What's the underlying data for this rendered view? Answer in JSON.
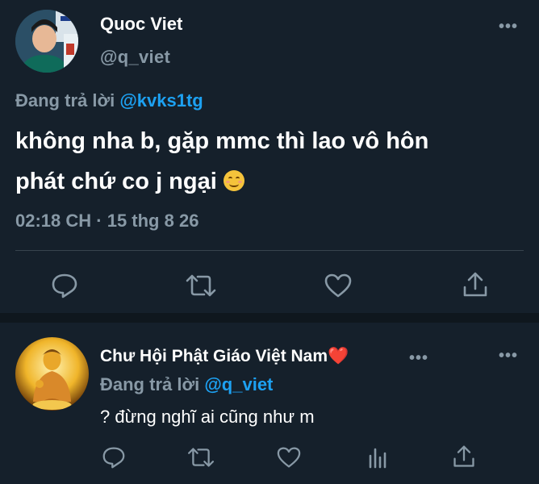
{
  "main_tweet": {
    "author_name": "Quoc Viet",
    "author_handle": "@q_viet",
    "replying_to_label": "Đang trả lời",
    "replying_to_handle": "@kvks1tg",
    "text_line1": "không nha b, gặp mmc thì lao vô hôn",
    "text_line2": "phát chứ co j ngại",
    "emoji": "smiling-face-with-smiling-eyes",
    "timestamp": "02:18 CH · 15 thg 8 26",
    "more_label": "•••",
    "actions": [
      "reply-icon",
      "retweet-icon",
      "like-icon",
      "share-icon"
    ]
  },
  "reply_tweet": {
    "author_name": "Chư Hội Phật Giáo Việt Nam",
    "author_name_emoji": "❤️",
    "inline_more_label": "•••",
    "more_label": "•••",
    "replying_to_label": "Đang trả lời",
    "replying_to_handle": "@q_viet",
    "text": "? đừng nghĩ ai cũng như m",
    "actions": [
      "reply-icon",
      "retweet-icon",
      "like-icon",
      "analytics-icon",
      "share-icon"
    ]
  },
  "colors": {
    "background": "#15202b",
    "text_primary": "#ffffff",
    "text_secondary": "#8899a6",
    "accent": "#1da1f2",
    "divider": "#38444d"
  }
}
